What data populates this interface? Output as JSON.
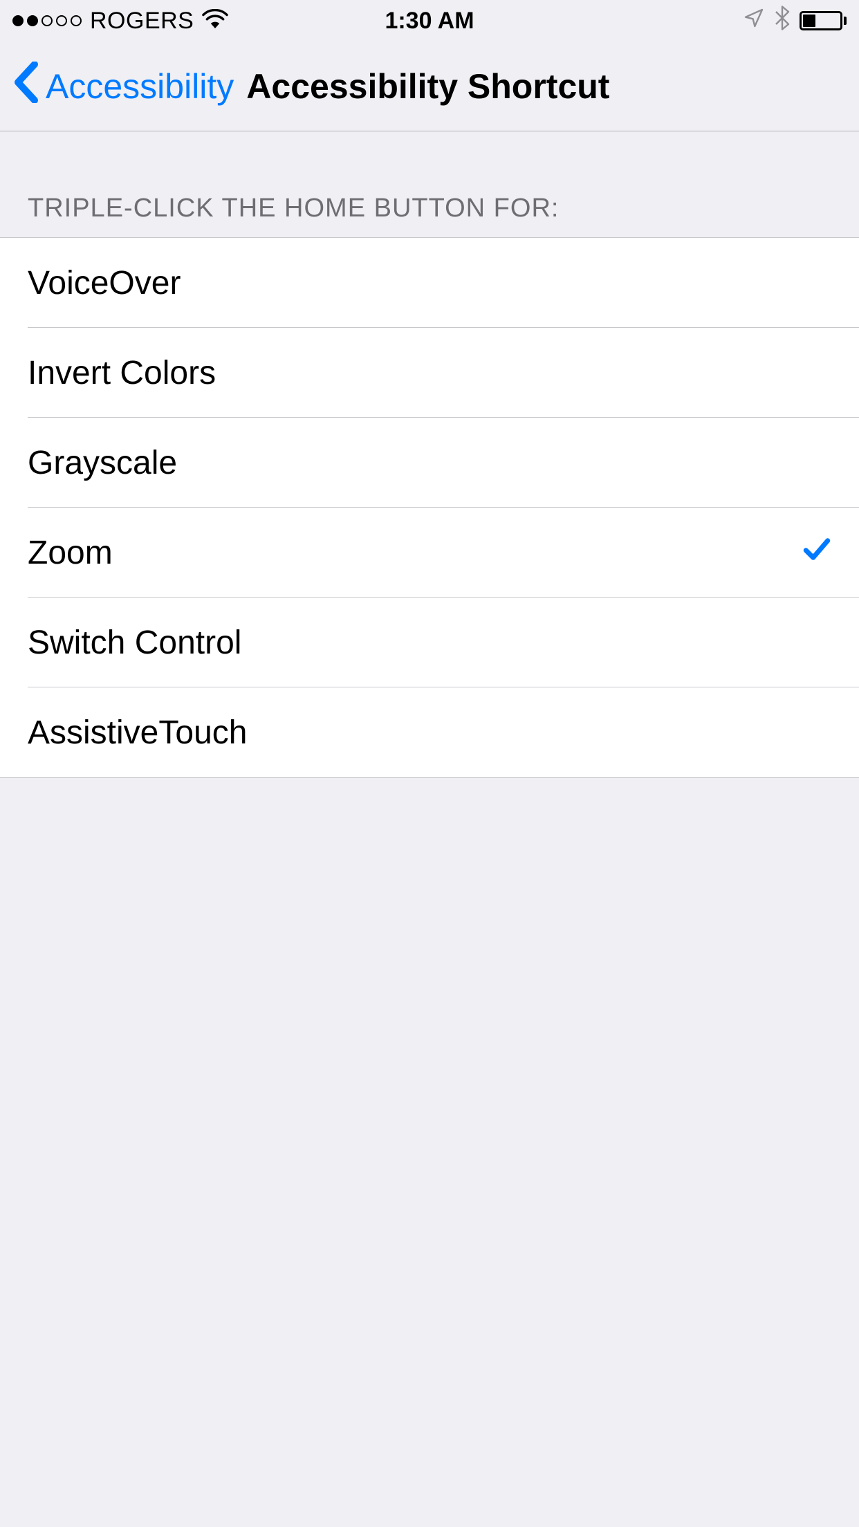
{
  "statusBar": {
    "carrier": "ROGERS",
    "time": "1:30 AM",
    "signalStrength": 2
  },
  "nav": {
    "backLabel": "Accessibility",
    "title": "Accessibility Shortcut"
  },
  "section": {
    "header": "TRIPLE-CLICK THE HOME BUTTON FOR:",
    "items": [
      {
        "label": "VoiceOver",
        "selected": false
      },
      {
        "label": "Invert Colors",
        "selected": false
      },
      {
        "label": "Grayscale",
        "selected": false
      },
      {
        "label": "Zoom",
        "selected": true
      },
      {
        "label": "Switch Control",
        "selected": false
      },
      {
        "label": "AssistiveTouch",
        "selected": false
      }
    ]
  },
  "colors": {
    "tint": "#007aff",
    "background": "#efeff4",
    "separator": "#c8c7cc",
    "sectionHeader": "#6d6d72"
  }
}
